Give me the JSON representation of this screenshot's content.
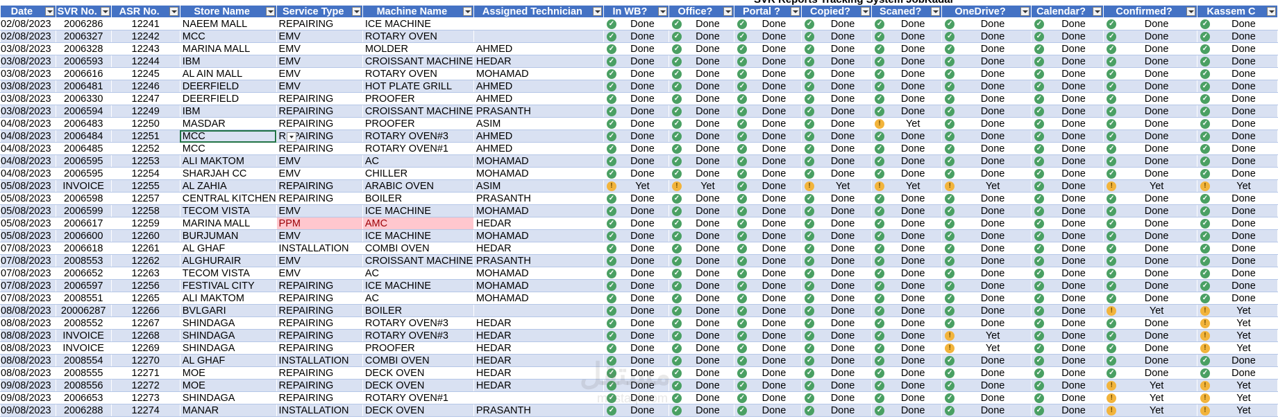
{
  "sheet_title": "SVR Reports Tracking System JobKadar",
  "watermark": "مستقل",
  "watermark_sub": "mostaql.com",
  "headers": [
    "Date",
    "SVR No.",
    "ASR No.",
    "Store Name",
    "Service Type",
    "Machine Name",
    "Assigned Technician",
    "In WB?",
    "Office?",
    "Portal ?",
    "Copied?",
    "Scaned?",
    "OneDrive?",
    "Calendar?",
    "Confirmed?",
    "Kassem C"
  ],
  "rows": [
    [
      "02/08/2023",
      "2006286",
      "12241",
      "NAEEM MALL",
      "REPAIRING",
      "ICE MACHINE",
      "",
      "Done",
      "Done",
      "Done",
      "Done",
      "Done",
      "Done",
      "Done",
      "Done",
      "Done"
    ],
    [
      "02/08/2023",
      "2006327",
      "12242",
      "MCC",
      "EMV",
      "ROTARY OVEN",
      "",
      "Done",
      "Done",
      "Done",
      "Done",
      "Done",
      "Done",
      "Done",
      "Done",
      "Done"
    ],
    [
      "03/08/2023",
      "2006328",
      "12243",
      "MARINA MALL",
      "EMV",
      "MOLDER",
      "AHMED",
      "Done",
      "Done",
      "Done",
      "Done",
      "Done",
      "Done",
      "Done",
      "Done",
      "Done"
    ],
    [
      "03/08/2023",
      "2006593",
      "12244",
      "IBM",
      "EMV",
      "CROISSANT MACHINE",
      "HEDAR",
      "Done",
      "Done",
      "Done",
      "Done",
      "Done",
      "Done",
      "Done",
      "Done",
      "Done"
    ],
    [
      "03/08/2023",
      "2006616",
      "12245",
      "AL AIN MALL",
      "EMV",
      "ROTARY OVEN",
      "MOHAMAD",
      "Done",
      "Done",
      "Done",
      "Done",
      "Done",
      "Done",
      "Done",
      "Done",
      "Done"
    ],
    [
      "03/08/2023",
      "2006481",
      "12246",
      "DEERFIELD",
      "EMV",
      "HOT PLATE GRILL",
      "AHMED",
      "Done",
      "Done",
      "Done",
      "Done",
      "Done",
      "Done",
      "Done",
      "Done",
      "Done"
    ],
    [
      "03/08/2023",
      "2006330",
      "12247",
      "DEERFIELD",
      "REPAIRING",
      "PROOFER",
      "AHMED",
      "Done",
      "Done",
      "Done",
      "Done",
      "Done",
      "Done",
      "Done",
      "Done",
      "Done"
    ],
    [
      "03/08/2023",
      "2006594",
      "12249",
      "IBM",
      "REPAIRING",
      "CROISSANT MACHINE",
      "PRASANTH",
      "Done",
      "Done",
      "Done",
      "Done",
      "Done",
      "Done",
      "Done",
      "Done",
      "Done"
    ],
    [
      "04/08/2023",
      "2006483",
      "12250",
      "MASDAR",
      "REPAIRING",
      "PROOFER",
      "ASIM",
      "Done",
      "Done",
      "Done",
      "Done",
      "Yet",
      "Done",
      "Done",
      "Done",
      "Done"
    ],
    [
      "04/08/2023",
      "2006484",
      "12251",
      "MCC",
      "REPAIRING",
      "ROTARY OVEN#3",
      "AHMED",
      "Done",
      "Done",
      "Done",
      "Done",
      "Done",
      "Done",
      "Done",
      "Done",
      "Done"
    ],
    [
      "04/08/2023",
      "2006485",
      "12252",
      "MCC",
      "REPAIRING",
      "ROTARY OVEN#1",
      "AHMED",
      "Done",
      "Done",
      "Done",
      "Done",
      "Done",
      "Done",
      "Done",
      "Done",
      "Done"
    ],
    [
      "04/08/2023",
      "2006595",
      "12253",
      "ALI MAKTOM",
      "EMV",
      "AC",
      "MOHAMAD",
      "Done",
      "Done",
      "Done",
      "Done",
      "Done",
      "Done",
      "Done",
      "Done",
      "Done"
    ],
    [
      "04/08/2023",
      "2006595",
      "12254",
      "SHARJAH CC",
      "EMV",
      "CHILLER",
      "MOHAMAD",
      "Done",
      "Done",
      "Done",
      "Done",
      "Done",
      "Done",
      "Done",
      "Done",
      "Done"
    ],
    [
      "05/08/2023",
      "INVOICE",
      "12255",
      "AL ZAHIA",
      "REPAIRING",
      "ARABIC OVEN",
      "ASIM",
      "Yet",
      "Yet",
      "Done",
      "Yet",
      "Yet",
      "Yet",
      "Done",
      "Yet",
      "Yet"
    ],
    [
      "05/08/2023",
      "2006598",
      "12257",
      "CENTRAL KITCHEN",
      "REPAIRING",
      "BOILER",
      "PRASANTH",
      "Done",
      "Done",
      "Done",
      "Done",
      "Done",
      "Done",
      "Done",
      "Done",
      "Done"
    ],
    [
      "05/08/2023",
      "2006599",
      "12258",
      "TECOM VISTA",
      "EMV",
      "ICE MACHINE",
      "MOHAMAD",
      "Done",
      "Done",
      "Done",
      "Done",
      "Done",
      "Done",
      "Done",
      "Done",
      "Done"
    ],
    [
      "05/08/2023",
      "2006617",
      "12259",
      "MARINA MALL",
      "PPM",
      "AMC",
      "HEDAR",
      "Done",
      "Done",
      "Done",
      "Done",
      "Done",
      "Done",
      "Done",
      "Done",
      "Done"
    ],
    [
      "05/08/2023",
      "2006600",
      "12260",
      "BURJUMAN",
      "EMV",
      "ICE MACHINE",
      "MOHAMAD",
      "Done",
      "Done",
      "Done",
      "Done",
      "Done",
      "Done",
      "Done",
      "Done",
      "Done"
    ],
    [
      "07/08/2023",
      "2006618",
      "12261",
      "AL GHAF",
      "INSTALLATION",
      "COMBI OVEN",
      "HEDAR",
      "Done",
      "Done",
      "Done",
      "Done",
      "Done",
      "Done",
      "Done",
      "Done",
      "Done"
    ],
    [
      "07/08/2023",
      "2008553",
      "12262",
      "ALGHURAIR",
      "EMV",
      "CROISSANT MACHINE",
      "PRASANTH",
      "Done",
      "Done",
      "Done",
      "Done",
      "Done",
      "Done",
      "Done",
      "Done",
      "Done"
    ],
    [
      "07/08/2023",
      "2006652",
      "12263",
      "TECOM VISTA",
      "EMV",
      "AC",
      "MOHAMAD",
      "Done",
      "Done",
      "Done",
      "Done",
      "Done",
      "Done",
      "Done",
      "Done",
      "Done"
    ],
    [
      "07/08/2023",
      "2006597",
      "12256",
      "FESTIVAL CITY",
      "REPAIRING",
      "ICE MACHINE",
      "MOHAMAD",
      "Done",
      "Done",
      "Done",
      "Done",
      "Done",
      "Done",
      "Done",
      "Done",
      "Done"
    ],
    [
      "07/08/2023",
      "2008551",
      "12265",
      "ALI MAKTOM",
      "REPAIRING",
      "AC",
      "MOHAMAD",
      "Done",
      "Done",
      "Done",
      "Done",
      "Done",
      "Done",
      "Done",
      "Done",
      "Done"
    ],
    [
      "08/08/2023",
      "20006287",
      "12266",
      "BVLGARI",
      "REPAIRING",
      "BOILER",
      "",
      "Done",
      "Done",
      "Done",
      "Done",
      "Done",
      "Done",
      "Done",
      "Yet",
      "Yet"
    ],
    [
      "08/08/2023",
      "2008552",
      "12267",
      "SHINDAGA",
      "REPAIRING",
      "ROTARY OVEN#3",
      "HEDAR",
      "Done",
      "Done",
      "Done",
      "Done",
      "Done",
      "Done",
      "Done",
      "Done",
      "Yet"
    ],
    [
      "08/08/2023",
      "INVOICE",
      "12268",
      "SHINDAGA",
      "REPAIRING",
      "ROTARY OVEN#3",
      "HEDAR",
      "Done",
      "Done",
      "Done",
      "Done",
      "Done",
      "Yet",
      "Done",
      "Done",
      "Yet"
    ],
    [
      "08/08/2023",
      "INVOICE",
      "12269",
      "SHINDAGA",
      "REPAIRING",
      "PROOFER",
      "HEDAR",
      "Done",
      "Done",
      "Done",
      "Done",
      "Done",
      "Yet",
      "Done",
      "Done",
      "Yet"
    ],
    [
      "08/08/2023",
      "2008554",
      "12270",
      "AL GHAF",
      "INSTALLATION",
      "COMBI OVEN",
      "HEDAR",
      "Done",
      "Done",
      "Done",
      "Done",
      "Done",
      "Done",
      "Done",
      "Done",
      "Done"
    ],
    [
      "08/08/2023",
      "2008555",
      "12271",
      "MOE",
      "REPAIRING",
      "DECK OVEN",
      "HEDAR",
      "Done",
      "Done",
      "Done",
      "Done",
      "Done",
      "Done",
      "Done",
      "Done",
      "Done"
    ],
    [
      "09/08/2023",
      "2008556",
      "12272",
      "MOE",
      "REPAIRING",
      "DECK OVEN",
      "HEDAR",
      "Done",
      "Done",
      "Done",
      "Done",
      "Done",
      "Done",
      "Done",
      "Yet",
      "Yet"
    ],
    [
      "09/08/2023",
      "2006653",
      "12273",
      "SHINDAGA",
      "REPAIRING",
      "ROTARY OVEN#1",
      "",
      "Done",
      "Done",
      "Done",
      "Done",
      "Done",
      "Done",
      "Done",
      "Yet",
      "Yet"
    ],
    [
      "09/08/2023",
      "2006288",
      "12274",
      "MANAR",
      "INSTALLATION",
      "DECK OVEN",
      "PRASANTH",
      "Done",
      "Done",
      "Done",
      "Done",
      "Done",
      "Done",
      "Done",
      "Yet",
      "Yet"
    ]
  ],
  "colors": {
    "header_bg": "#4472c4",
    "band": "#d9e1f2",
    "done": "#4aa063",
    "yet": "#f2b43c",
    "no": "#e05a2b",
    "ppm_bg": "#ffc7ce"
  }
}
